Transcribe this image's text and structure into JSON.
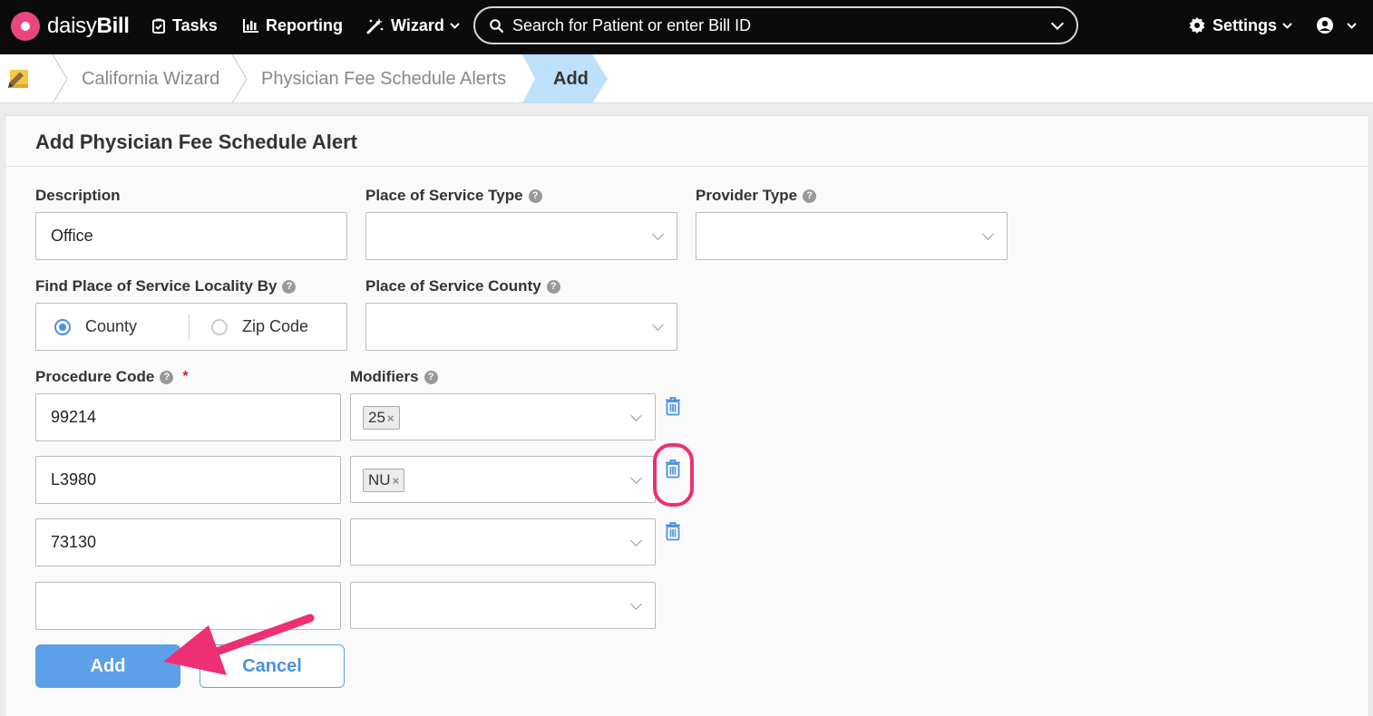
{
  "nav": {
    "logo": {
      "light": "daisy",
      "bold": "Bill"
    },
    "tasks": "Tasks",
    "reporting": "Reporting",
    "wizard": "Wizard",
    "search_placeholder": "Search for Patient or enter Bill ID",
    "settings": "Settings"
  },
  "breadcrumb": {
    "items": [
      "California Wizard",
      "Physician Fee Schedule Alerts"
    ],
    "current": "Add"
  },
  "form": {
    "title": "Add Physician Fee Schedule Alert",
    "description_label": "Description",
    "description_value": "Office",
    "pos_type_label": "Place of Service Type",
    "provider_type_label": "Provider Type",
    "find_locality_label": "Find Place of Service Locality By",
    "locality_options": [
      "County",
      "Zip Code"
    ],
    "locality_selected": "County",
    "pos_county_label": "Place of Service County",
    "procedure_label": "Procedure Code",
    "required_marker": "*",
    "modifiers_label": "Modifiers",
    "rows": [
      {
        "code": "99214",
        "modifier": "25"
      },
      {
        "code": "L3980",
        "modifier": "NU"
      },
      {
        "code": "73130",
        "modifier": ""
      },
      {
        "code": "",
        "modifier": ""
      }
    ],
    "add_button": "Add",
    "cancel_button": "Cancel"
  },
  "colors": {
    "accent": "#5ba0e8",
    "highlight": "#ee2f74",
    "nav_bg": "#0b0b0b",
    "breadcrumb_active": "#bde0fb"
  }
}
